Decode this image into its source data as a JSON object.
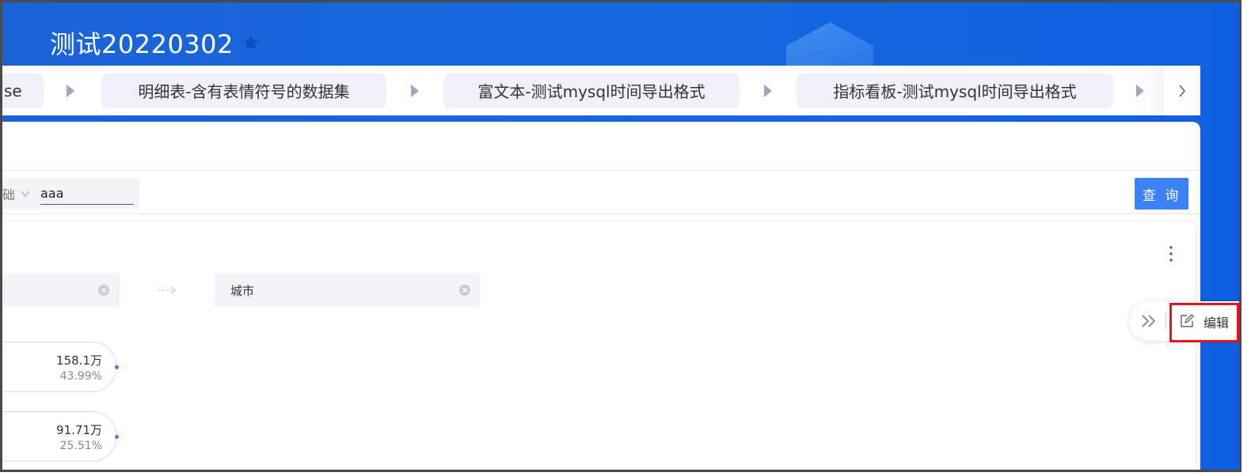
{
  "header": {
    "title": "测试20220302"
  },
  "tabs": {
    "items": [
      {
        "label": "se"
      },
      {
        "label": "明细表-含有表情符号的数据集"
      },
      {
        "label": "富文本-测试mysql时间导出格式"
      },
      {
        "label": "指标看板-测试mysql时间导出格式"
      }
    ]
  },
  "filter": {
    "truncated_label": "础",
    "input_value": "aaa",
    "query_label": "查 询"
  },
  "widget": {
    "dimension_right_label": "城市",
    "nodes": [
      {
        "value": "158.1万",
        "percent": "43.99%"
      },
      {
        "value": "91.71万",
        "percent": "25.51%"
      }
    ]
  },
  "toolbar": {
    "edit_label": "编辑"
  },
  "colors": {
    "primary": "#3b82f6",
    "banner": "#1668e0",
    "highlight": "#e8141a"
  }
}
